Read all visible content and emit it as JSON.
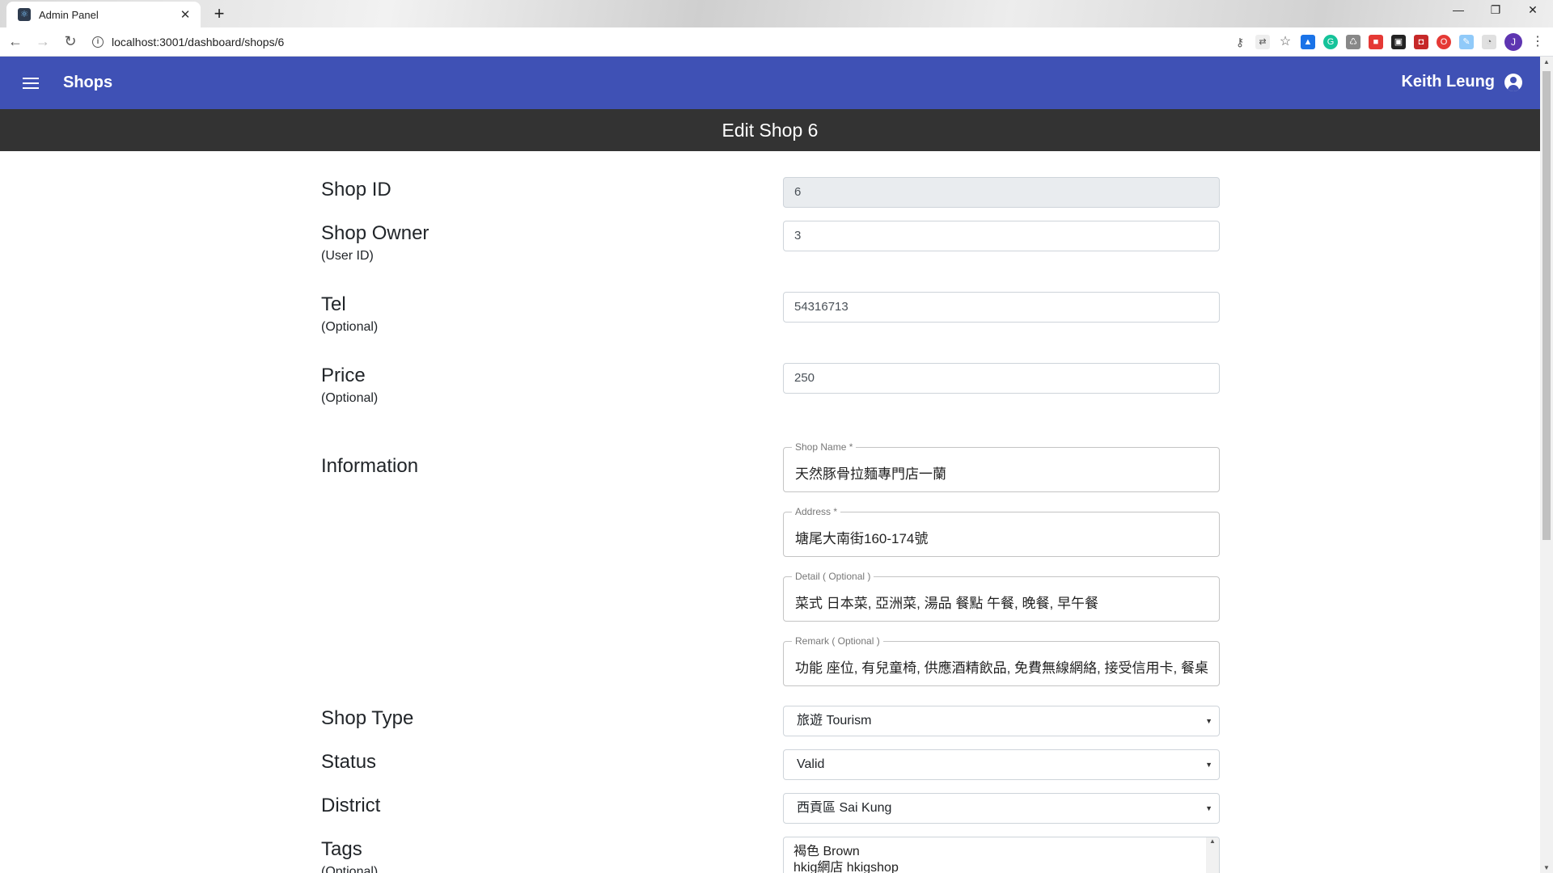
{
  "browser": {
    "tab_title": "Admin Panel",
    "url": "localhost:3001/dashboard/shops/6",
    "profile_initial": "J"
  },
  "appbar": {
    "title": "Shops",
    "user_name": "Keith Leung"
  },
  "page": {
    "heading": "Edit Shop 6"
  },
  "form": {
    "shop_id": {
      "label": "Shop ID",
      "value": "6"
    },
    "shop_owner": {
      "label": "Shop Owner",
      "sublabel": "(User ID)",
      "value": "3"
    },
    "tel": {
      "label": "Tel",
      "sublabel": "(Optional)",
      "value": "54316713"
    },
    "price": {
      "label": "Price",
      "sublabel": "(Optional)",
      "value": "250"
    },
    "information": {
      "label": "Information",
      "shop_name": {
        "label": "Shop Name *",
        "value": "天然豚骨拉麵專門店一蘭"
      },
      "address": {
        "label": "Address *",
        "value": "塘尾大南街160-174號"
      },
      "detail": {
        "label": "Detail ( Optional )",
        "value": "菜式 日本菜, 亞洲菜, 湯品 餐點 午餐, 晚餐, 早午餐"
      },
      "remark": {
        "label": "Remark ( Optional )",
        "value": "功能 座位, 有兒童椅, 供應酒精飲品, 免費無線網絡, 接受信用卡, 餐桌服務"
      }
    },
    "shop_type": {
      "label": "Shop Type",
      "value": "旅遊 Tourism"
    },
    "status": {
      "label": "Status",
      "value": "Valid"
    },
    "district": {
      "label": "District",
      "value": "西貢區 Sai Kung"
    },
    "tags": {
      "label": "Tags",
      "sublabel": "(Optional)",
      "options": [
        "褐色 Brown",
        "hkig網店 hkigshop"
      ]
    }
  }
}
